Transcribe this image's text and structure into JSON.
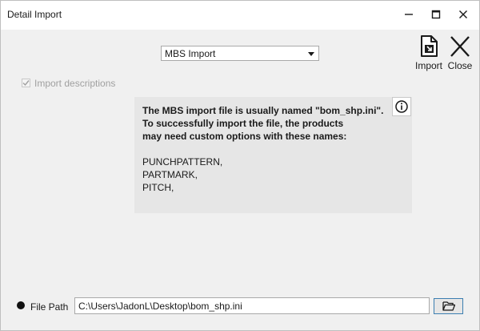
{
  "window": {
    "title": "Detail Import",
    "controls": [
      "minimize-icon",
      "maximize-icon",
      "close-icon"
    ]
  },
  "import_type": {
    "selected": "MBS Import"
  },
  "toolbar": {
    "import_label": "Import",
    "import_icon": "file-import-icon",
    "close_label": "Close",
    "close_icon": "close-icon"
  },
  "options": {
    "import_descriptions_label": "Import descriptions",
    "import_descriptions_checked": true,
    "import_descriptions_enabled": false
  },
  "info": {
    "line1": "The MBS import file is usually named \"bom_shp.ini\".",
    "line2": "To successfully import the file, the products",
    "line3": "may need custom options with these names:",
    "names": [
      "PUNCHPATTERN,",
      "PARTMARK,",
      "PITCH,"
    ],
    "icon": "info-icon"
  },
  "file": {
    "label": "File Path",
    "value": "C:\\Users\\JadonL\\Desktop\\bom_shp.ini",
    "browse_icon": "folder-open-icon"
  },
  "colors": {
    "background": "#f0f0f0",
    "panel": "#e6e6e6",
    "browse_border": "#3c7fb1"
  }
}
